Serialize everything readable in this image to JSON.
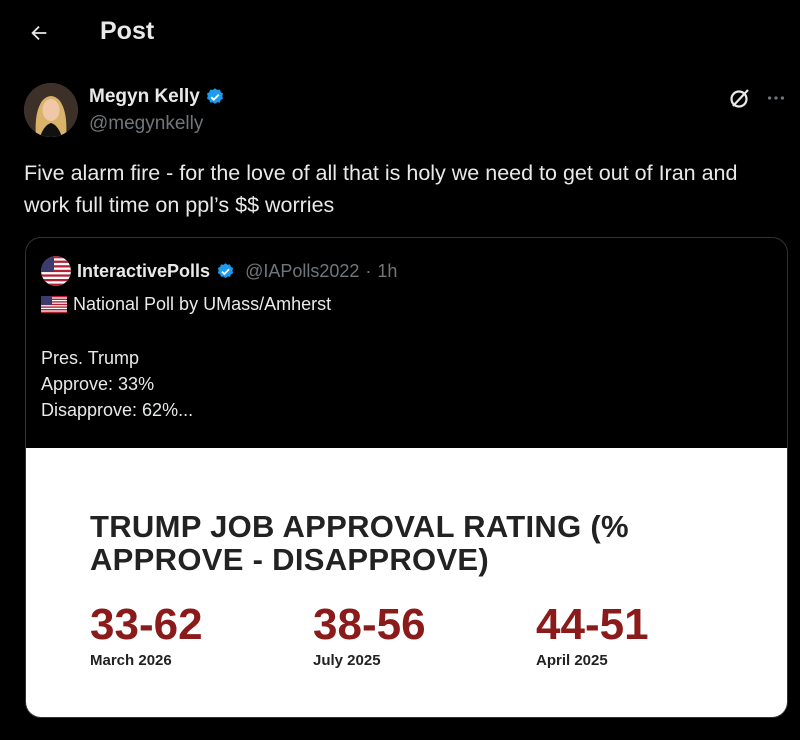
{
  "header": {
    "title": "Post"
  },
  "post": {
    "author_name": "Megyn Kelly",
    "author_handle": "@megynkelly",
    "text": "Five alarm fire - for the love of all that is holy we need to get out of Iran and work full time on ppl’s $$ worries"
  },
  "quote": {
    "author_name": "InteractivePolls",
    "author_handle": "@IAPolls2022",
    "separator": "·",
    "time": "1h",
    "line1": "National Poll by UMass/Amherst",
    "line2": "Pres. Trump",
    "line3": "Approve: 33%",
    "line4": "Disapprove: 62%..."
  },
  "media": {
    "title": "TRUMP JOB APPROVAL RATING (% APPROVE - DISAPPROVE)",
    "stats": [
      {
        "value": "33-62",
        "label": "March 2026"
      },
      {
        "value": "38-56",
        "label": "July 2025"
      },
      {
        "value": "44-51",
        "label": "April 2025"
      }
    ]
  },
  "colors": {
    "background": "#000000",
    "text": "#e7e9ea",
    "muted": "#71767b",
    "verified": "#1d9bf0",
    "stat_red": "#8b1a1a"
  },
  "icons": {
    "back": "arrow-left-icon",
    "verified": "verified-badge-icon",
    "grok": "grok-icon",
    "more": "more-icon",
    "flag": "us-flag-icon"
  }
}
